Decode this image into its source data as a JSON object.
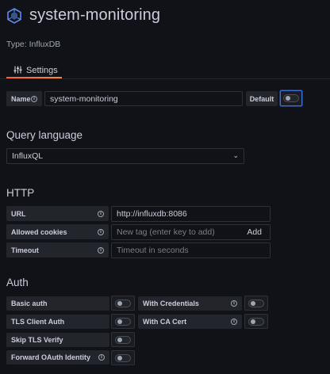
{
  "header": {
    "title": "system-monitoring",
    "type_line": "Type: InfluxDB",
    "icon": "influxdb-logo-icon"
  },
  "tabs": [
    {
      "label": "Settings",
      "icon": "sliders-icon"
    }
  ],
  "name_row": {
    "label": "Name",
    "value": "system-monitoring",
    "default_label": "Default",
    "default_on": false
  },
  "query_language": {
    "heading": "Query language",
    "selected": "InfluxQL"
  },
  "http": {
    "heading": "HTTP",
    "url_label": "URL",
    "url_value": "http://influxdb:8086",
    "cookies_label": "Allowed cookies",
    "cookies_placeholder": "New tag (enter key to add)",
    "cookies_add": "Add",
    "timeout_label": "Timeout",
    "timeout_placeholder": "Timeout in seconds"
  },
  "auth": {
    "heading": "Auth",
    "basic_auth": "Basic auth",
    "with_credentials": "With Credentials",
    "tls_client_auth": "TLS Client Auth",
    "with_ca_cert": "With CA Cert",
    "skip_tls_verify": "Skip TLS Verify",
    "forward_oauth": "Forward OAuth Identity"
  },
  "colors": {
    "background": "#111217",
    "panel": "#22252b",
    "accent_tab": "#f55f3e",
    "focus_blue": "#3d71d9",
    "icon_blue": "#5b8dee"
  }
}
